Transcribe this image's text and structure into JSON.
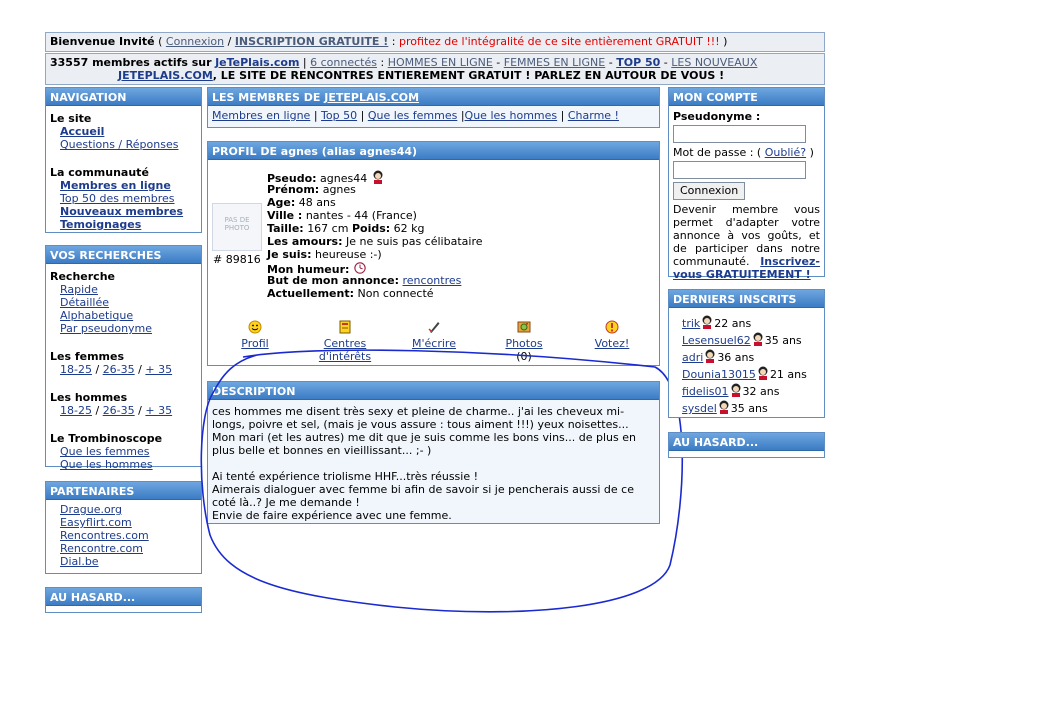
{
  "top": {
    "welcome": "Bienvenue Invité",
    "open_paren": "(",
    "connexion": "Connexion",
    "slash": "/",
    "inscription": "INSCRIPTION GRATUITE !",
    "colon": ":",
    "promo": "profitez de l'intégralité de ce site entièrement GRATUIT !!!",
    "close_paren": ")",
    "members_text": "33557 membres actifs sur",
    "site_link": "JeTePlais.com",
    "sep": "|",
    "connected": "6 connectés",
    "colon2": ":",
    "hommes_en_ligne": "HOMMES EN LIGNE",
    "dash1": "-",
    "femmes_en_ligne": "FEMMES EN LIGNE",
    "dash2": "-",
    "top50": "TOP 50",
    "dash3": "-",
    "nouveaux": "LES NOUVEAUX",
    "site_upper": "JETEPLAIS.COM",
    "tagline": ", LE SITE DE RENCONTRES ENTIEREMENT GRATUIT ! PARLEZ EN AUTOUR DE VOUS !"
  },
  "nav": {
    "title": "NAVIGATION",
    "site_label": "Le site",
    "accueil": "Accueil",
    "questions": "Questions / Réponses",
    "communaute_label": "La communauté",
    "membres_en_ligne": "Membres en ligne",
    "top50": "Top 50 des membres",
    "nouveaux": "Nouveaux membres",
    "temoignages": "Temoignages"
  },
  "recherches": {
    "title": "VOS RECHERCHES",
    "recherche_label": "Recherche",
    "rapide": "Rapide",
    "detaillee": "Détaillée",
    "alpha": "Alphabetique",
    "pseudo": "Par pseudonyme",
    "femmes_label": "Les femmes",
    "f1": "18-25",
    "f2": "26-35",
    "f3": "+ 35",
    "hommes_label": "Les hommes",
    "h1": "18-25",
    "h2": "26-35",
    "h3": "+ 35",
    "slash": "/",
    "trombi_label": "Le Trombinoscope",
    "trombi_f": "Que les femmes",
    "trombi_h": "Que les hommes"
  },
  "partenaires": {
    "title": "PARTENAIRES",
    "links": [
      "Drague.org",
      "Easyflirt.com",
      "Rencontres.com",
      "Rencontre.com",
      "Dial.be"
    ]
  },
  "hasard_left": {
    "title": "AU HASARD..."
  },
  "membres": {
    "title_prefix": "LES MEMBRES DE",
    "title_link": "JETEPLAIS.COM",
    "l1": "Membres en ligne",
    "l2": "Top 50",
    "l3": "Que les femmes",
    "l4": "Que les hommes",
    "l5": "Charme !",
    "sep": "|"
  },
  "profil": {
    "title": "PROFIL DE agnes (alias agnes44)",
    "photo_text": "PAS DE PHOTO",
    "member_id": "# 89816",
    "pseudo_lbl": "Pseudo:",
    "pseudo_val": "agnes44",
    "prenom_lbl": "Prénom:",
    "prenom_val": "agnes",
    "age_lbl": "Age:",
    "age_val": "48 ans",
    "ville_lbl": "Ville :",
    "ville_val": "nantes - 44 (France)",
    "taille_lbl": "Taille:",
    "taille_val": "167 cm",
    "poids_lbl": "Poids:",
    "poids_val": "62 kg",
    "amours_lbl": "Les amours:",
    "amours_val": "Je ne suis pas célibataire",
    "suis_lbl": "Je suis:",
    "suis_val": "heureuse :-)",
    "humeur_lbl": "Mon humeur:",
    "but_lbl": "But de mon annonce:",
    "but_val": "rencontres",
    "actuel_lbl": "Actuellement:",
    "actuel_val": "Non connecté",
    "actions": {
      "profil": "Profil",
      "centres_1": "Centres",
      "centres_2": "d'intérêts",
      "ecrire": "M'écrire",
      "photos": "Photos",
      "photos_count": "(0)",
      "votez": "Votez!"
    }
  },
  "description": {
    "title": "DESCRIPTION",
    "lines": [
      "ces hommes me disent très sexy et pleine de charme.. j'ai les cheveux mi-",
      "longs, poivre et sel, (mais je vous assure : tous aiment !!!) yeux noisettes...",
      "Mon mari (et les autres) me dit que je suis comme les bons vins... de plus en",
      "plus belle et bonnes en vieillissant... ;- )",
      "",
      "Ai tenté expérience triolisme HHF...très réussie !",
      "Aimerais dialoguer avec femme bi afin de savoir si je pencherais aussi de ce",
      "coté là..? Je me demande !",
      "Envie de faire expérience avec une femme."
    ]
  },
  "compte": {
    "title": "MON COMPTE",
    "pseudo_lbl": "Pseudonyme :",
    "pass_lbl": "Mot de passe : (",
    "oublie": "Oublié?",
    "pass_close": ")",
    "connexion_btn": "Connexion",
    "text": "Devenir membre vous permet d'adapter votre annonce à vos goûts, et de participer dans notre communauté.",
    "inscrivez": "Inscrivez-vous GRATUITEMENT !"
  },
  "inscrits": {
    "title": "DERNIERS INSCRITS",
    "items": [
      {
        "name": "trik",
        "age": "22 ans"
      },
      {
        "name": "Lesensuel62",
        "age": "35 ans"
      },
      {
        "name": "adri",
        "age": "36 ans"
      },
      {
        "name": "Dounia13015",
        "age": "21 ans"
      },
      {
        "name": "fidelis01",
        "age": "32 ans"
      },
      {
        "name": "sysdel",
        "age": "35 ans"
      }
    ]
  },
  "hasard_right": {
    "title": "AU HASARD..."
  },
  "colors": {
    "header_top": "#6ea6e0",
    "header_bottom": "#3c7cc4",
    "link": "#1e3c8c",
    "promo_red": "#e00000",
    "annotation_blue": "#1a2ad0"
  }
}
